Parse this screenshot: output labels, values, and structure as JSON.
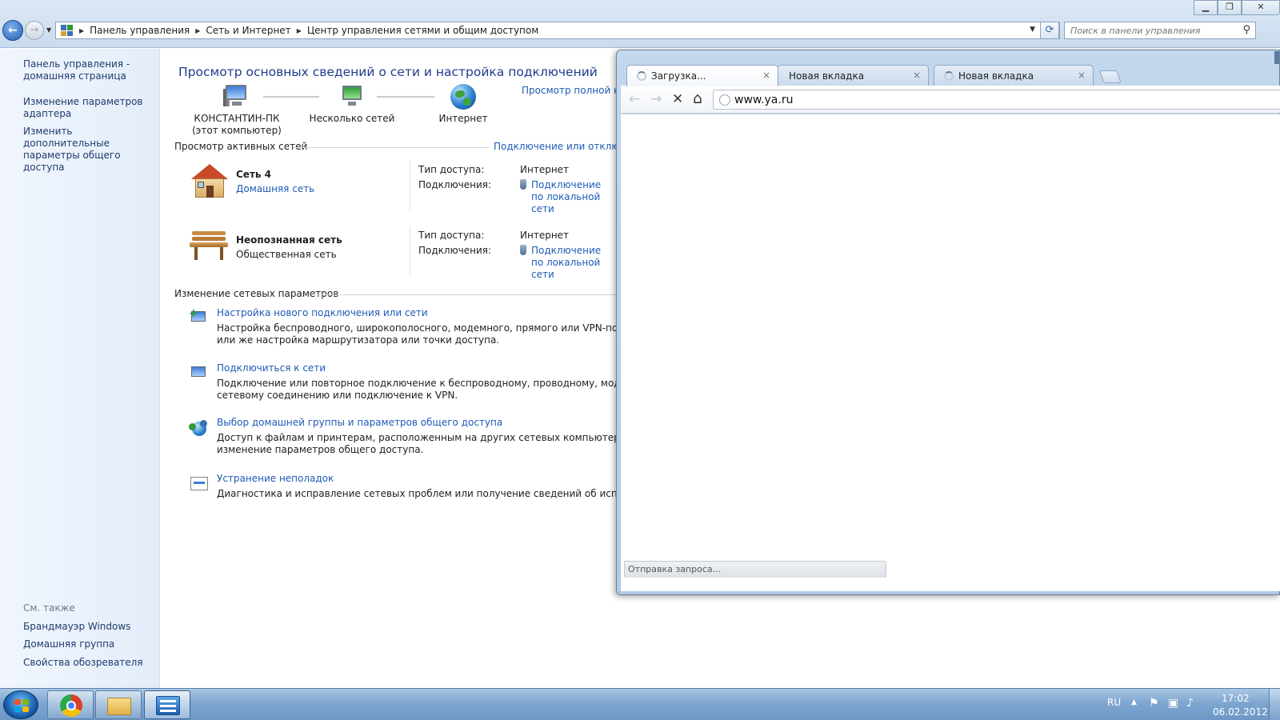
{
  "explorer": {
    "window_controls": {
      "minimize": "▁",
      "maximize": "❐",
      "close": "✕"
    },
    "nav": {
      "back_glyph": "←",
      "forward_glyph": "→",
      "history_glyph": "▼"
    },
    "breadcrumb": [
      "Панель управления",
      "Сеть и Интернет",
      "Центр управления сетями и общим доступом"
    ],
    "search_placeholder": "Поиск в панели управления"
  },
  "sidebar": {
    "links": [
      "Панель управления - домашняя страница",
      "Изменение параметров адаптера",
      "Изменить дополнительные параметры общего доступа"
    ],
    "see_also_heading": "См. также",
    "see_also_links": [
      "Брандмауэр Windows",
      "Домашняя группа",
      "Свойства обозревателя"
    ]
  },
  "main": {
    "title": "Просмотр основных сведений о сети и настройка подключений",
    "view_full_map": "Просмотр полной карты",
    "map_nodes": [
      {
        "label": "КОНСТАНТИН-ПК",
        "sublabel": "(этот компьютер)",
        "icon": "computer-icon"
      },
      {
        "label": "Несколько сетей",
        "icon": "multiple-networks-icon"
      },
      {
        "label": "Интернет",
        "icon": "globe-icon"
      }
    ],
    "active_networks_heading": "Просмотр активных сетей",
    "connect_disconnect": "Подключение или отключение",
    "active_networks": [
      {
        "name": "Сеть  4",
        "type": "Домашняя сеть",
        "type_is_link": true,
        "icon": "house-icon",
        "access_label": "Тип доступа:",
        "access_value": "Интернет",
        "connections_label": "Подключения:",
        "connections_value": "Подключение по локальной сети"
      },
      {
        "name": "Неопознанная сеть",
        "type": "Общественная сеть",
        "type_is_link": false,
        "icon": "bench-icon",
        "access_label": "Тип доступа:",
        "access_value": "Интернет",
        "connections_label": "Подключения:",
        "connections_value": "Подключение по локальной сети"
      }
    ],
    "change_settings_heading": "Изменение сетевых параметров",
    "tasks": [
      {
        "title": "Настройка нового подключения или сети",
        "desc_line1": "Настройка беспроводного, широкополосного, модемного, прямого или VPN-подключения",
        "desc_line2": "или же настройка маршрутизатора или точки доступа.",
        "icon": "new-connection-icon"
      },
      {
        "title": "Подключиться к сети",
        "desc_line1": "Подключение или повторное подключение к беспроводному, проводному, модемному",
        "desc_line2": "сетевому соединению или подключение к VPN.",
        "icon": "connect-network-icon"
      },
      {
        "title": "Выбор домашней группы и параметров общего доступа",
        "desc_line1": "Доступ к файлам и принтерам, расположенным на других сетевых компьютерах, или",
        "desc_line2": "изменение параметров общего доступа.",
        "icon": "homegroup-icon"
      },
      {
        "title": "Устранение неполадок",
        "desc_line1": "Диагностика и исправление сетевых проблем или получение сведений об исправлении.",
        "desc_line2": "",
        "icon": "troubleshoot-icon"
      }
    ]
  },
  "chrome": {
    "tabs": [
      {
        "title": "Загрузка...",
        "active": true,
        "loading": true
      },
      {
        "title": "Новая вкладка",
        "active": false,
        "loading": false
      },
      {
        "title": "Новая вкладка",
        "active": false,
        "loading": true
      }
    ],
    "tab_close_glyph": "×",
    "toolbar": {
      "back": "←",
      "forward": "→",
      "stop": "✕",
      "home": "⌂"
    },
    "url": "www.ya.ru",
    "status": "Отправка запроса..."
  },
  "taskbar": {
    "pinned": [
      "Google Chrome",
      "Проводник",
      "Панель управления"
    ],
    "language": "RU",
    "tray_arrow": "▲",
    "time": "17:02",
    "date": "06.02.2012"
  }
}
